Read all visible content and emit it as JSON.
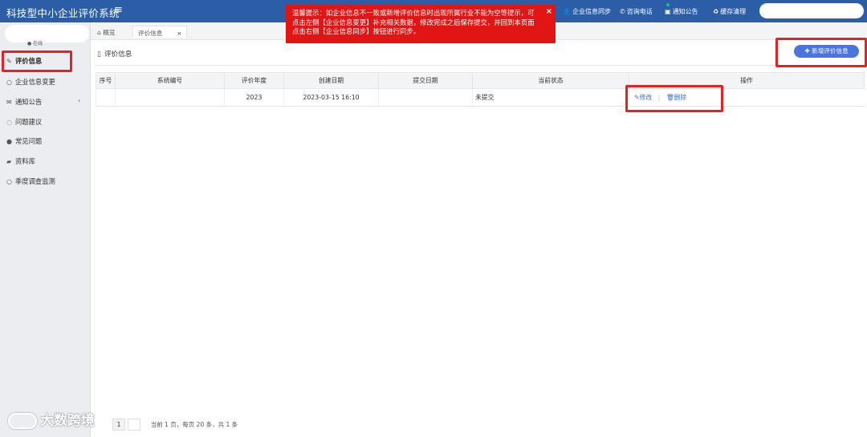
{
  "header": {
    "app_title": "科技型中小企业评价系统",
    "menu_icon": "hamburger-icon",
    "nav": [
      {
        "label": "企业信息同步",
        "icon": "user-icon"
      },
      {
        "label": "咨询电话",
        "icon": "phone-icon"
      },
      {
        "label": "通知公告",
        "icon": "bell-icon"
      },
      {
        "label": "缓存清理",
        "icon": "recycle-icon"
      }
    ],
    "brand_color": "#2c5ea8"
  },
  "alert": {
    "text": "温馨提示：如企业信息不一致或新增评价信息时出现所属行业不能为空等提示，可点击左侧【企业信息变更】补充相关数据，修改完成之后保存提交，并回到本页面点击右侧【企业信息同步】按钮进行同步。",
    "close_glyph": "×",
    "color": "#e21515"
  },
  "sidebar": {
    "user_card_suffix": "● 在线",
    "items": [
      {
        "label": "评价信息",
        "icon": "edit-icon"
      },
      {
        "label": "企业信息变更",
        "icon": "circle-icon"
      },
      {
        "label": "通知公告",
        "icon": "mail-icon"
      },
      {
        "label": "问题建议",
        "icon": "chat-icon"
      },
      {
        "label": "常见问题",
        "icon": "question-icon"
      },
      {
        "label": "资料库",
        "icon": "folder-icon"
      },
      {
        "label": "季度调查监测",
        "icon": "circle-icon"
      }
    ],
    "arrow_glyph": "‹"
  },
  "tabs": [
    {
      "label": "概览",
      "icon": "home-icon"
    },
    {
      "label": "评价信息",
      "close": "×"
    }
  ],
  "content": {
    "title": "评价信息",
    "add_button": "新增评价信息",
    "table": {
      "headers": [
        "序号",
        "系统编号",
        "评价年度",
        "创建日期",
        "提交日期",
        "当前状态",
        "操作"
      ],
      "rows": [
        {
          "seq": "",
          "sys_no": "",
          "year": "2023",
          "created": "2023-03-15 16:10",
          "submitted": "",
          "status": "未提交",
          "edit": "修改",
          "delete": "删除"
        }
      ]
    }
  },
  "pagination": {
    "current_page": "1",
    "info": "当前 1 页，每页 20 条，共 1 条"
  },
  "watermark": {
    "text": "大数跨境"
  }
}
